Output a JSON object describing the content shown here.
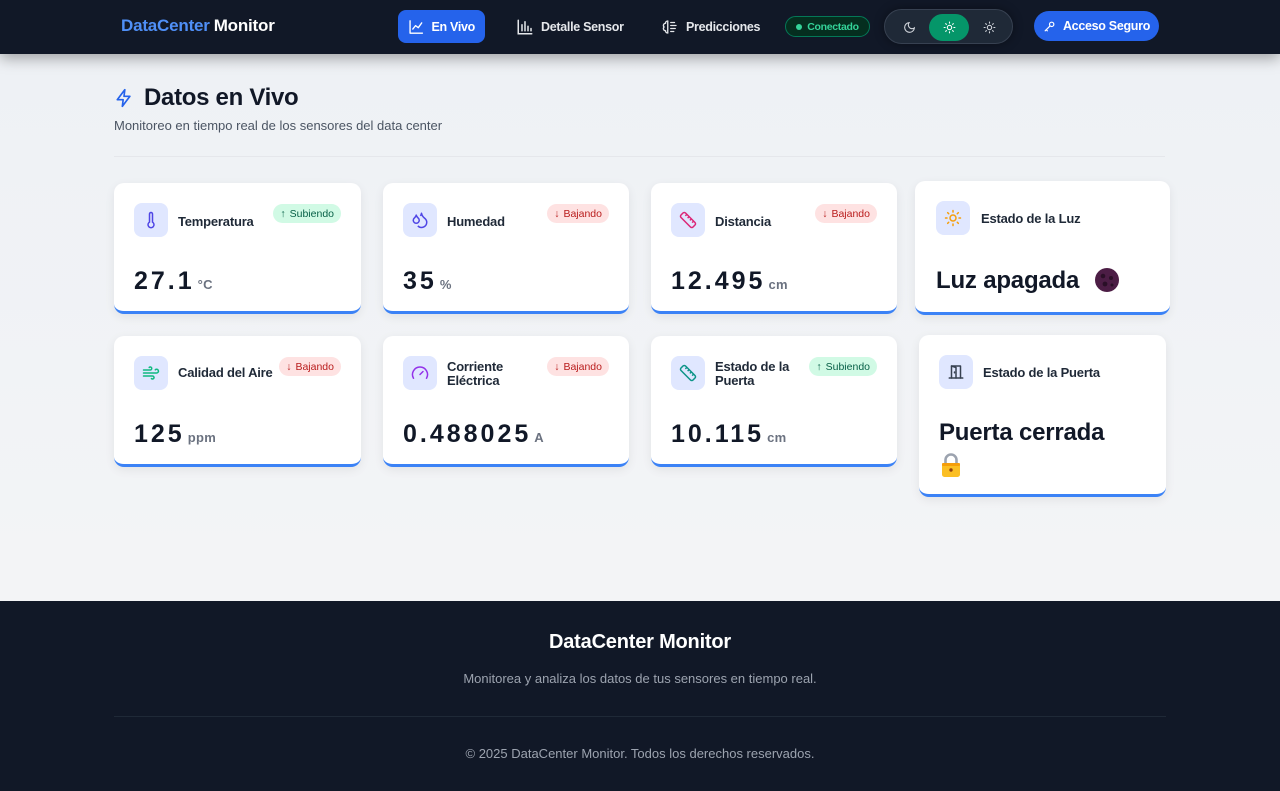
{
  "brand": {
    "part1": "DataCenter",
    "part2": "Monitor"
  },
  "nav": {
    "live": "En Vivo",
    "sensor_detail": "Detalle Sensor",
    "predictions": "Predicciones"
  },
  "status": {
    "connected": "Conectado"
  },
  "theme_toggle": {
    "options": [
      "moon-icon",
      "sun-icon",
      "sun-small-icon"
    ],
    "selected": "sun-icon"
  },
  "secure_access": "Acceso Seguro",
  "page": {
    "title": "Datos en Vivo",
    "subtitle": "Monitoreo en tiempo real de los sensores del data center"
  },
  "cards": {
    "temperature": {
      "label": "Temperatura",
      "trend": "Subiendo",
      "value": "27.1",
      "unit": "°C"
    },
    "humidity": {
      "label": "Humedad",
      "trend": "Bajando",
      "value": "35",
      "unit": "%"
    },
    "distance": {
      "label": "Distancia",
      "trend": "Bajando",
      "value": "12.495",
      "unit": "cm"
    },
    "light": {
      "label": "Estado de la Luz",
      "state": "Luz apagada"
    },
    "air": {
      "label": "Calidad del Aire",
      "trend": "Bajando",
      "value": "125",
      "unit": "ppm"
    },
    "current": {
      "label_l1": "Corriente",
      "label_l2": "Eléctrica",
      "trend": "Bajando",
      "value": "0.488025",
      "unit": "A"
    },
    "door_sensor": {
      "label_l1": "Estado de la",
      "label_l2": "Puerta",
      "trend": "Subiendo",
      "value": "10.115",
      "unit": "cm"
    },
    "door": {
      "label": "Estado de la Puerta",
      "state": "Puerta cerrada"
    }
  },
  "colors": {
    "accent": "#2563eb",
    "header_bg": "#111827",
    "trend_up": "#065f46",
    "trend_down": "#b91c1c",
    "connected": "#34d399"
  },
  "footer": {
    "title": "DataCenter Monitor",
    "description": "Monitorea y analiza los datos de tus sensores en tiempo real.",
    "copyright": "© 2025 DataCenter Monitor. Todos los derechos reservados."
  }
}
